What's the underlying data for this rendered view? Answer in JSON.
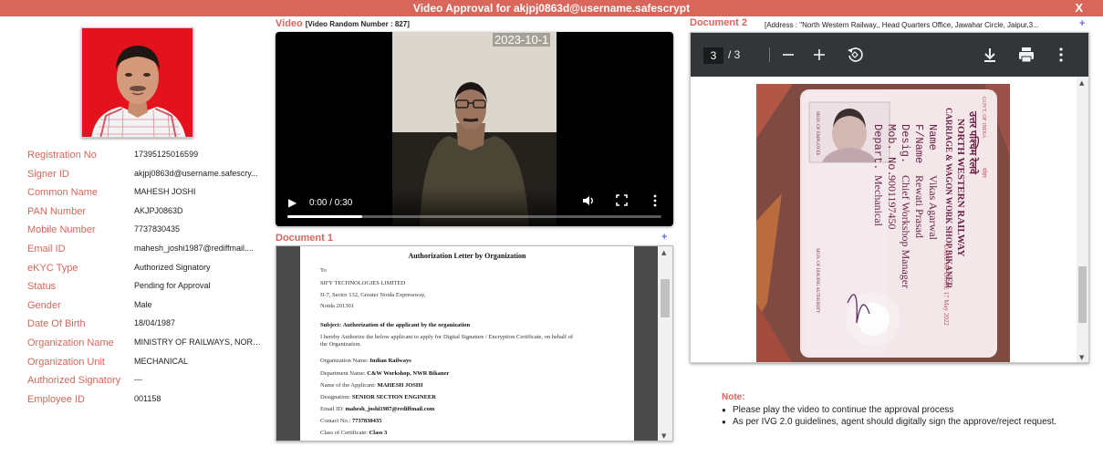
{
  "window": {
    "title": "Video Approval for akjpj0863d@username.safescrypt",
    "close_label": "X"
  },
  "details": [
    {
      "label": "Registration No",
      "value": "17395125016599"
    },
    {
      "label": "Signer ID",
      "value": "akjpj0863d@username.safescry..."
    },
    {
      "label": "Common Name",
      "value": "MAHESH JOSHI"
    },
    {
      "label": "PAN Number",
      "value": "AKJPJ0863D"
    },
    {
      "label": "Mobile Number",
      "value": "7737830435"
    },
    {
      "label": "Email ID",
      "value": "mahesh_joshi1987@rediffmail...."
    },
    {
      "label": "eKYC Type",
      "value": "Authorized Signatory"
    },
    {
      "label": "Status",
      "value": "Pending for Approval"
    },
    {
      "label": "Gender",
      "value": "Male"
    },
    {
      "label": "Date Of Birth",
      "value": "18/04/1987"
    },
    {
      "label": "Organization Name",
      "value": "MINISTRY OF RAILWAYS, NORTH..."
    },
    {
      "label": "Organization Unit",
      "value": "MECHANICAL"
    },
    {
      "label": "Authorized Signatory",
      "value": "---"
    },
    {
      "label": "Employee ID",
      "value": "001158"
    }
  ],
  "video": {
    "title": "Video",
    "random_number": "[Video Random Number : 827]",
    "timestamp": "2023-10-1",
    "time": "0:00 / 0:30",
    "progress_fraction": 0.2
  },
  "document1": {
    "title": "Document 1",
    "plus": "+",
    "letter": {
      "heading": "Authorization Letter by Organization",
      "to": "To",
      "company": "SIFY TECHNOLOGIES LIMITED",
      "addr1": "II-7, Sector 132, Greater Noida Expressway,",
      "addr2": "Noida 201301",
      "subject_label": "Subject:",
      "subject": "Authorization of the applicant by the organization",
      "body1": "I hereby Authorize the below applicant to apply for Digital Signature / Encryption Certificate, on behalf of",
      "body2": "the Organization.",
      "org_label": "Organization Name:",
      "org": "Indian Railways",
      "dept_label": "Department Name:",
      "dept": "C&W Workshop, NWR Bikaner",
      "applicant_label": "Name of the Applicant:",
      "applicant": "MAHESH JOSHI",
      "desig_label": "Designation:",
      "desig": "SENIOR SECTION ENGINEER",
      "email_label": "Email ID:",
      "email": "mahesh_joshi1987@rediffmail.com",
      "contact_label": "Contact No.:",
      "contact": "7737830435",
      "class_label": "Class of Certificate:",
      "class": "Class 3"
    }
  },
  "document2": {
    "title": "Document 2",
    "address": "[Address : \"North Western Railway,, Head Quarters Office, Jawahar Circle, Jaipur,3...",
    "plus": "+",
    "page_current": "3",
    "page_total": "/ 3",
    "card": {
      "hindi_org": "उत्तर पश्चिम रेलवे",
      "railway": "NORTH WESTERN RAILWAY",
      "workshop": "CARRIAGE & WAGON WORK SHOP BIKANER",
      "name_label": "Name",
      "name": "Vikas Agarwal",
      "fname_label": "F/Name",
      "fname": "Rewati Prasad",
      "desig_label": "Desig.",
      "desig": "Chief Workshop Manager",
      "mob_label": "Mob. No.",
      "mob": "9001197450",
      "depart_label": "Depart.",
      "depart": "Mechanical",
      "issue": "DATE OF ISSUE 17 May 2022",
      "sign_employee": "SIGN. OF EMPLOYEE",
      "sign_authority": "SIGN. OF ISSUING AUTHORITY"
    }
  },
  "note": {
    "title": "Note:",
    "items": [
      "Please play the video to continue the approval process",
      "As per IVG 2.0 guidelines, agent should digitally sign the approve/reject request."
    ]
  },
  "colors": {
    "accent": "#d9665b",
    "plus": "#5b6ee1",
    "pdf_toolbar": "#323639"
  }
}
